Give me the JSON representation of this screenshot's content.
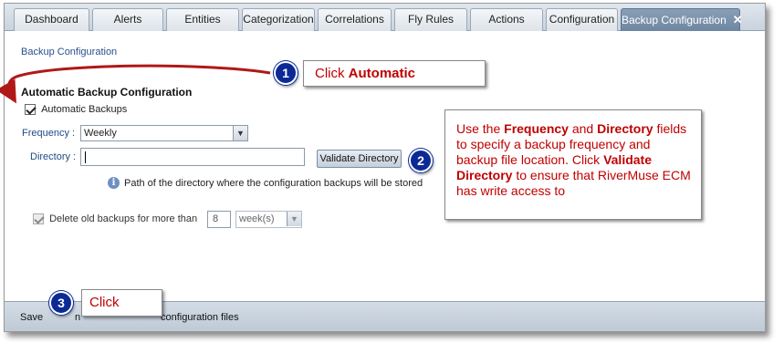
{
  "tabs": [
    {
      "label": "Dashboard"
    },
    {
      "label": "Alerts"
    },
    {
      "label": "Entities"
    },
    {
      "label": "Categorization"
    },
    {
      "label": "Correlations"
    },
    {
      "label": "Fly Rules"
    },
    {
      "label": "Actions"
    },
    {
      "label": "Configuration"
    },
    {
      "label": "Backup Configuration",
      "close": "✕"
    }
  ],
  "breadcrumb": "Backup Configuration",
  "section_title": "Automatic Backup Configuration",
  "automatic_backups": {
    "label": "Automatic Backups",
    "checked": true
  },
  "frequency": {
    "label": "Frequency :",
    "value": "Weekly"
  },
  "directory": {
    "label": "Directory :",
    "value": "",
    "validate_button": "Validate Directory"
  },
  "directory_hint": "Path of the directory where the configuration backups will be stored",
  "delete_old": {
    "label": "Delete old backups for more than",
    "count": "8",
    "unit": "week(s)",
    "checked": true
  },
  "footer": {
    "save_label": "Save",
    "trailing_text": "configuration files"
  },
  "callouts": {
    "step1": {
      "badge": "1",
      "prefix": "Click ",
      "bold": "Automatic"
    },
    "step2": {
      "badge": "2",
      "t1": "Use the ",
      "b1": "Frequency",
      "t2": " and ",
      "b2": "Directory",
      "t3": " fields to specify a backup frequency and backup file location. Click ",
      "b3": "Validate Directory",
      "t4": " to ensure that RiverMuse ECM has write access to"
    },
    "step3": {
      "badge": "3",
      "text": "Click"
    }
  },
  "colors": {
    "callout_text": "#c00000",
    "badge": "#0c2a96",
    "arrow": "#b01818",
    "active_tab": "#6e86a2"
  }
}
